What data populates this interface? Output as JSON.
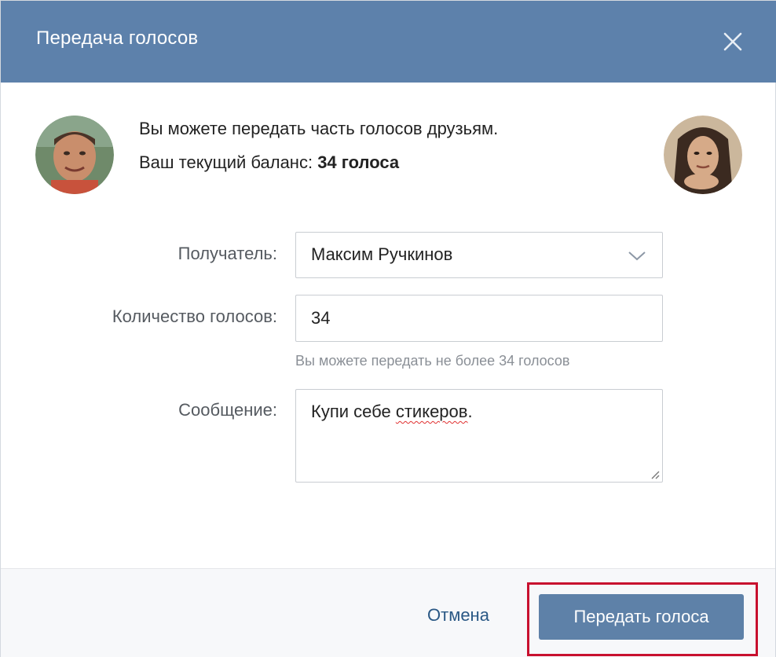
{
  "dialog": {
    "title": "Передача голосов",
    "close_icon": "close-icon"
  },
  "info": {
    "line1": "Вы можете передать часть голосов друзьям.",
    "line2_prefix": "Ваш текущий баланс: ",
    "balance": "34 голоса"
  },
  "form": {
    "recipient_label": "Получатель:",
    "recipient_value": "Максим Ручкинов",
    "count_label": "Количество голосов:",
    "count_value": "34",
    "count_hint": "Вы можете передать не более 34 голосов",
    "message_label": "Сообщение:",
    "message_word1": "Купи себе ",
    "message_word2": "стикеров",
    "message_end": "."
  },
  "footer": {
    "cancel_label": "Отмена",
    "submit_label": "Передать голоса"
  },
  "colors": {
    "header": "#5d81ab",
    "button": "#5e81a8",
    "link": "#2a5885",
    "highlight": "#c8102e"
  }
}
